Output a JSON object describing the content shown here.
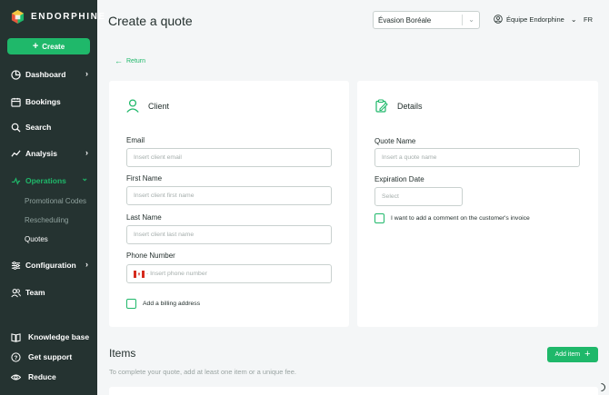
{
  "brand": {
    "name": "ENDORPHINE",
    "accent": "#1fb86a",
    "sidebar_bg": "#253331"
  },
  "sidebar": {
    "create_label": "Create",
    "items": [
      {
        "label": "Dashboard",
        "icon": "dashboard-icon",
        "chevron": true
      },
      {
        "label": "Bookings",
        "icon": "calendar-icon",
        "chevron": false
      },
      {
        "label": "Search",
        "icon": "search-icon",
        "chevron": false
      },
      {
        "label": "Analysis",
        "icon": "analysis-icon",
        "chevron": true
      },
      {
        "label": "Operations",
        "icon": "operations-icon",
        "chevron": true,
        "active": true
      },
      {
        "label": "Configuration",
        "icon": "sliders-icon",
        "chevron": true
      },
      {
        "label": "Team",
        "icon": "team-icon",
        "chevron": false
      }
    ],
    "sub_items": [
      "Promotional Codes",
      "Rescheduling",
      "Quotes"
    ],
    "active_sub_item": "Quotes",
    "footer": [
      {
        "label": "Knowledge base",
        "icon": "book-icon"
      },
      {
        "label": "Get support",
        "icon": "help-icon"
      },
      {
        "label": "Reduce",
        "icon": "eye-icon"
      }
    ]
  },
  "header": {
    "title": "Create a quote",
    "company_select": "Évasion Boréale",
    "team_menu": "Équipe Endorphine",
    "language": "FR"
  },
  "return_label": "Return",
  "client_card": {
    "title": "Client",
    "email_label": "Email",
    "email_placeholder": "Insert client email",
    "first_name_label": "First Name",
    "first_name_placeholder": "Insert client first name",
    "last_name_label": "Last Name",
    "last_name_placeholder": "Insert client last name",
    "phone_label": "Phone Number",
    "phone_placeholder": "- Insert phone number",
    "billing_label": "Add a billing address"
  },
  "details_card": {
    "title": "Details",
    "quote_name_label": "Quote Name",
    "quote_name_placeholder": "Insert a quote name",
    "expiration_label": "Expiration Date",
    "expiration_placeholder": "Select",
    "comment_label": "I want to add a comment on the customer's invoice"
  },
  "items": {
    "title": "Items",
    "description": "To complete your quote, add at least one item or a unique fee.",
    "add_label": "Add item"
  }
}
